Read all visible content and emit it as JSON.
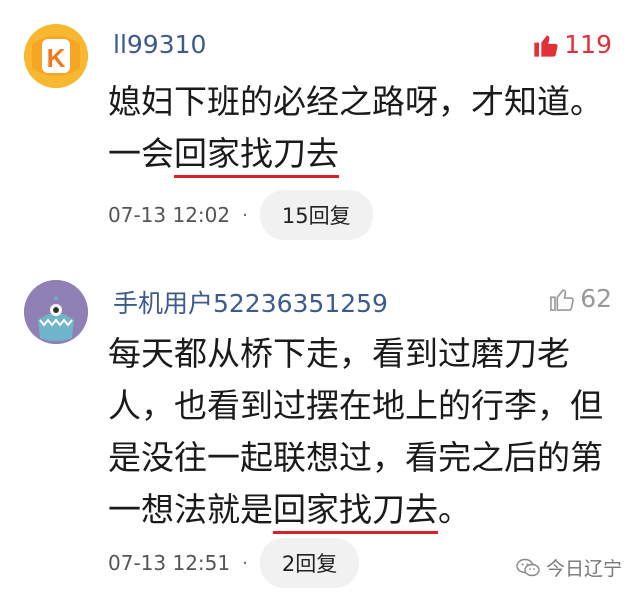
{
  "comments": [
    {
      "username": "ll99310",
      "likes": "119",
      "liked": true,
      "text_before": "媳妇下班的必经之路呀，才知道。一会",
      "text_highlight": "回家找刀去",
      "text_after": "",
      "time": "07-13 12:02",
      "dot": "·",
      "replies": "15回复",
      "avatar_letter": "K"
    },
    {
      "username": "手机用户52236351259",
      "likes": "62",
      "liked": false,
      "text_before": "每天都从桥下走，看到过磨刀老人，也看到过摆在地上的行李，但是没往一起联想过，看完之后的第一想法就是",
      "text_highlight": "回家找刀去",
      "text_after": "。",
      "time": "07-13 12:51",
      "dot": "·",
      "replies": "2回复"
    }
  ],
  "watermark": {
    "text": "今日辽宁",
    "icon": "wechat-icon"
  },
  "colors": {
    "username": "#3d5a8a",
    "like_active": "#e0313a",
    "like_inactive": "#999999",
    "underline": "#d9212a"
  }
}
